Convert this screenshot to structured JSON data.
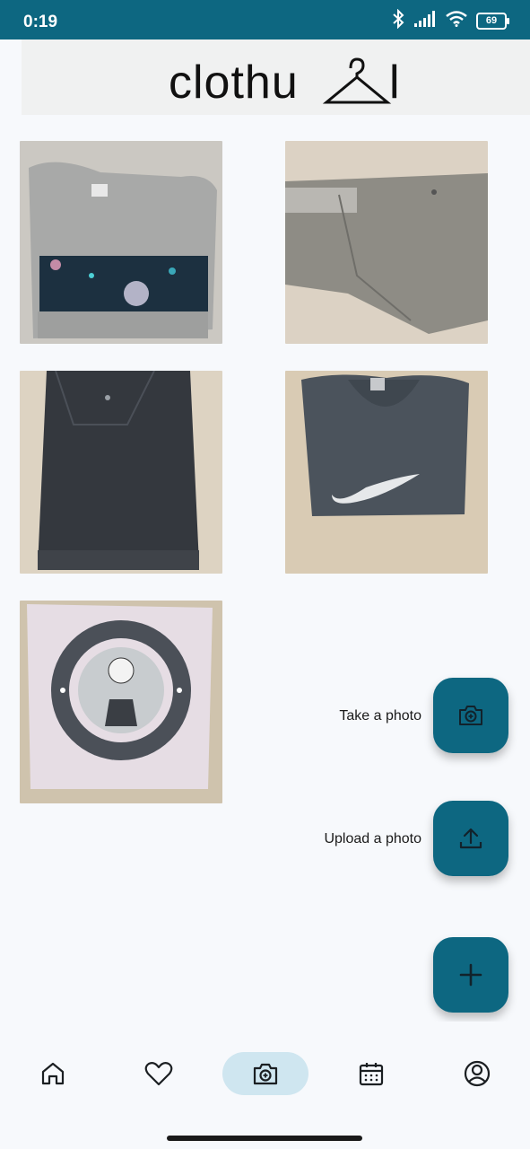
{
  "status_bar": {
    "time": "0:19",
    "battery": "69",
    "icons": [
      "bluetooth-icon",
      "signal-icon",
      "wifi-icon",
      "battery-icon"
    ]
  },
  "app": {
    "logo_text": "clothu",
    "logo_end": "l",
    "brand_color": "#0d6781"
  },
  "gallery": {
    "items": [
      {
        "name": "gray-galaxy-tshirt"
      },
      {
        "name": "gray-pants"
      },
      {
        "name": "black-denim-skirt"
      },
      {
        "name": "nike-sweatshirt"
      },
      {
        "name": "pink-russell-sweatshirt"
      }
    ]
  },
  "fab_menu": {
    "take_photo_label": "Take a photo",
    "upload_photo_label": "Upload a photo",
    "main_icon": "plus-icon"
  },
  "nav": {
    "items": [
      {
        "icon": "home-icon"
      },
      {
        "icon": "heart-icon"
      },
      {
        "icon": "camera-icon",
        "active": true
      },
      {
        "icon": "calendar-icon"
      },
      {
        "icon": "profile-icon"
      }
    ]
  }
}
